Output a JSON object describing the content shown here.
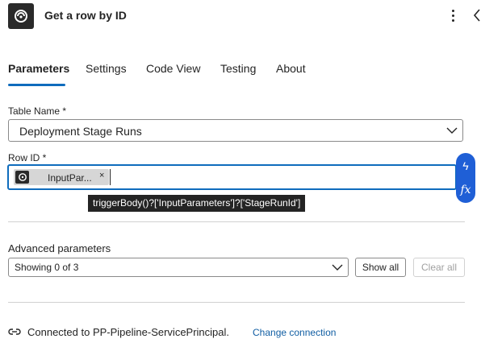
{
  "header": {
    "title": "Get a row by ID",
    "app_icon": "dataverse-icon",
    "more_icon": "more-vertical-icon",
    "collapse_icon": "chevron-left-icon"
  },
  "tabs": [
    {
      "label": "Parameters",
      "active": true
    },
    {
      "label": "Settings",
      "active": false
    },
    {
      "label": "Code View",
      "active": false
    },
    {
      "label": "Testing",
      "active": false
    },
    {
      "label": "About",
      "active": false
    }
  ],
  "fields": {
    "table_name": {
      "label": "Table Name *",
      "value": "Deployment Stage Runs"
    },
    "row_id": {
      "label": "Row ID *",
      "token_label": "InputPar...",
      "token_remove": "×",
      "tooltip": "triggerBody()?['InputParameters']?['StageRunId']"
    }
  },
  "side_actions": {
    "dynamic_content_icon": "lightning-icon",
    "dynamic_content_glyph": "ϟ",
    "expression_icon": "fx-icon",
    "expression_glyph": "fx"
  },
  "advanced": {
    "label": "Advanced parameters",
    "value": "Showing 0 of 3",
    "show_all": "Show all",
    "clear_all": "Clear all"
  },
  "connection": {
    "icon": "connection-icon",
    "text": "Connected to PP-Pipeline-ServicePrincipal.",
    "change_link": "Change connection"
  },
  "colors": {
    "accent": "#0f6cbd",
    "side_pill": "#1f5fd6",
    "link": "#115ea3",
    "tooltip_bg": "#242424",
    "token_bg": "#d6d6d6"
  }
}
